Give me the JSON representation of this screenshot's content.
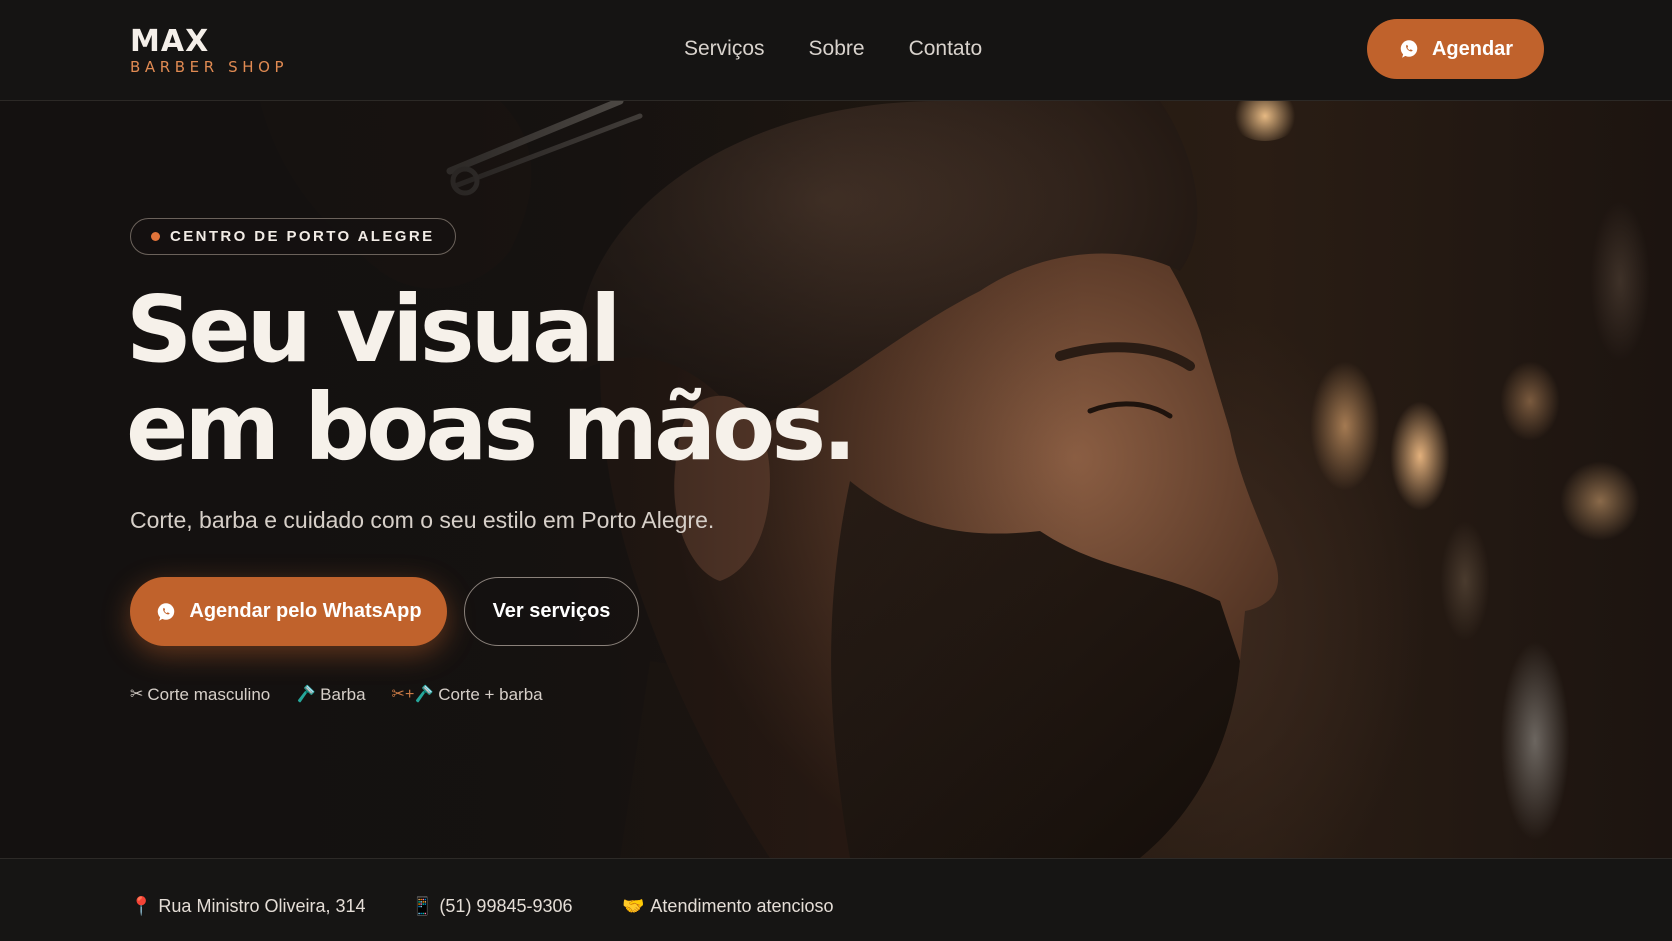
{
  "brand": {
    "name": "MAX",
    "tagline": "BARBER SHOP"
  },
  "nav": {
    "items": [
      {
        "label": "Serviços"
      },
      {
        "label": "Sobre"
      },
      {
        "label": "Contato"
      }
    ]
  },
  "header": {
    "cta_label": "Agendar",
    "cta_icon": "whatsapp-icon"
  },
  "hero": {
    "badge": "CENTRO DE PORTO ALEGRE",
    "headline_line1": "Seu visual",
    "headline_line2": "em boas mãos.",
    "subtitle": "Corte, barba e cuidado com o seu estilo em Porto Alegre.",
    "primary_cta": "Agendar pelo WhatsApp",
    "secondary_cta": "Ver serviços",
    "services": [
      {
        "icon": "✂",
        "label": "Corte masculino"
      },
      {
        "icon": "🪒",
        "label": "Barba"
      },
      {
        "icon": "✂+🪒",
        "label": "Corte + barba"
      }
    ]
  },
  "info": {
    "address": "Rua Ministro Oliveira, 314",
    "address_icon": "📍",
    "phone": "(51) 99845-9306",
    "phone_icon": "📱",
    "service_note": "Atendimento atencioso",
    "service_icon": "🤝"
  },
  "colors": {
    "accent": "#c0622c",
    "accent_light": "#e08a52",
    "background": "#141211",
    "text": "#f2ece6"
  }
}
